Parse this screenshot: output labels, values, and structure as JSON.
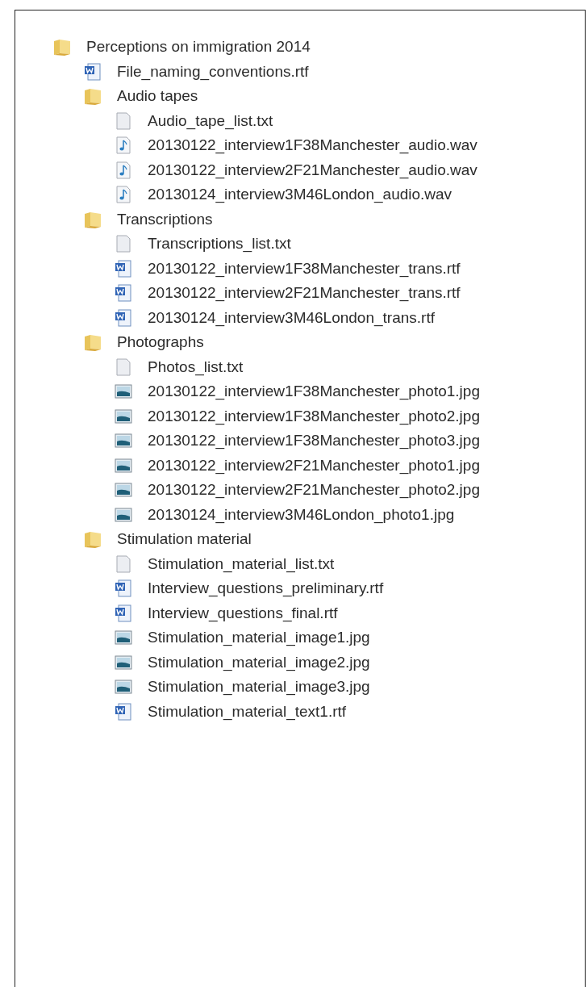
{
  "tree": [
    {
      "kind": "folder",
      "label": "Perceptions on immigration 2014",
      "children": [
        {
          "kind": "word",
          "label": "File_naming_conventions.rtf"
        },
        {
          "kind": "folder",
          "label": "Audio tapes",
          "children": [
            {
              "kind": "text",
              "label": "Audio_tape_list.txt"
            },
            {
              "kind": "audio",
              "label": "20130122_interview1F38Manchester_audio.wav"
            },
            {
              "kind": "audio",
              "label": "20130122_interview2F21Manchester_audio.wav"
            },
            {
              "kind": "audio",
              "label": "20130124_interview3M46London_audio.wav"
            }
          ]
        },
        {
          "kind": "folder",
          "label": "Transcriptions",
          "children": [
            {
              "kind": "text",
              "label": "Transcriptions_list.txt"
            },
            {
              "kind": "word",
              "label": "20130122_interview1F38Manchester_trans.rtf"
            },
            {
              "kind": "word",
              "label": "20130122_interview2F21Manchester_trans.rtf"
            },
            {
              "kind": "word",
              "label": "20130124_interview3M46London_trans.rtf"
            }
          ]
        },
        {
          "kind": "folder",
          "label": "Photographs",
          "children": [
            {
              "kind": "text",
              "label": "Photos_list.txt"
            },
            {
              "kind": "image",
              "label": "20130122_interview1F38Manchester_photo1.jpg"
            },
            {
              "kind": "image",
              "label": "20130122_interview1F38Manchester_photo2.jpg"
            },
            {
              "kind": "image",
              "label": "20130122_interview1F38Manchester_photo3.jpg"
            },
            {
              "kind": "image",
              "label": "20130122_interview2F21Manchester_photo1.jpg"
            },
            {
              "kind": "image",
              "label": "20130122_interview2F21Manchester_photo2.jpg"
            },
            {
              "kind": "image",
              "label": "20130124_interview3M46London_photo1.jpg"
            }
          ]
        },
        {
          "kind": "folder",
          "label": "Stimulation material",
          "children": [
            {
              "kind": "text",
              "label": "Stimulation_material_list.txt"
            },
            {
              "kind": "word",
              "label": "Interview_questions_preliminary.rtf"
            },
            {
              "kind": "word",
              "label": "Interview_questions_final.rtf"
            },
            {
              "kind": "image",
              "label": "Stimulation_material_image1.jpg"
            },
            {
              "kind": "image",
              "label": "Stimulation_material_image2.jpg"
            },
            {
              "kind": "image",
              "label": "Stimulation_material_image3.jpg"
            },
            {
              "kind": "word",
              "label": "Stimulation_material_text1.rtf"
            }
          ]
        }
      ]
    }
  ]
}
